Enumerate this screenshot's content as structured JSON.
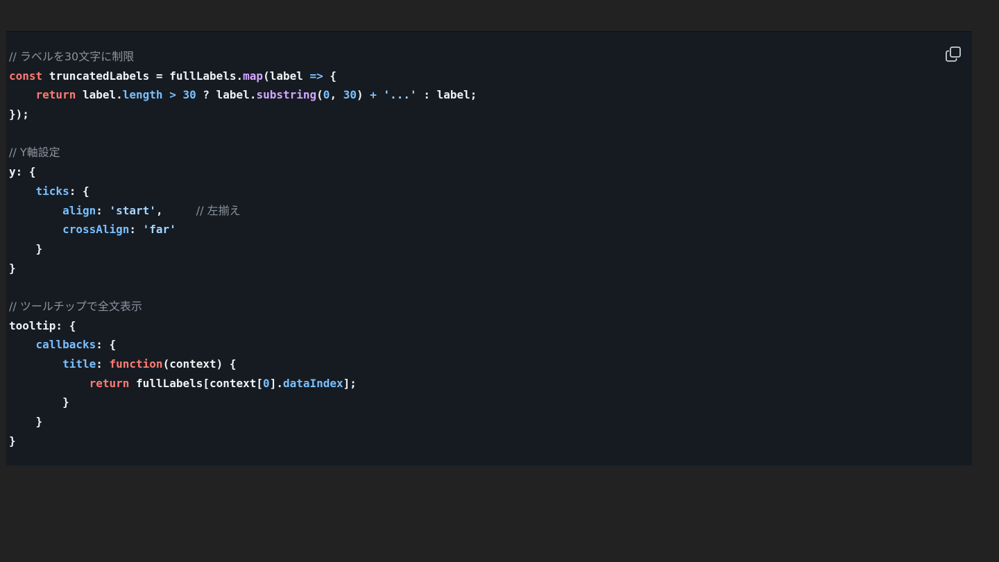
{
  "colors": {
    "background": "#222222",
    "code_background": "#161b22",
    "keyword": "#ff7b72",
    "function": "#d2a8ff",
    "property": "#79c0ff",
    "string": "#a5d6ff",
    "comment": "#8b949e",
    "text": "#f0f3f6"
  },
  "copy_button": {
    "icon": "copy-icon"
  },
  "code_lines": [
    [
      {
        "t": "cm",
        "v": "// ラベルを30文字に制限"
      }
    ],
    [
      {
        "t": "kw",
        "v": "const"
      },
      {
        "t": "plain",
        "v": " truncatedLabels = fullLabels."
      },
      {
        "t": "fn",
        "v": "map"
      },
      {
        "t": "plain",
        "v": "(label "
      },
      {
        "t": "op",
        "v": "=>"
      },
      {
        "t": "plain",
        "v": " {"
      }
    ],
    [
      {
        "t": "plain",
        "v": "    "
      },
      {
        "t": "kw",
        "v": "return"
      },
      {
        "t": "plain",
        "v": " label."
      },
      {
        "t": "prop",
        "v": "length"
      },
      {
        "t": "plain",
        "v": " "
      },
      {
        "t": "op",
        "v": ">"
      },
      {
        "t": "plain",
        "v": " "
      },
      {
        "t": "num",
        "v": "30"
      },
      {
        "t": "plain",
        "v": " ? label."
      },
      {
        "t": "fn",
        "v": "substring"
      },
      {
        "t": "plain",
        "v": "("
      },
      {
        "t": "num",
        "v": "0"
      },
      {
        "t": "plain",
        "v": ", "
      },
      {
        "t": "num",
        "v": "30"
      },
      {
        "t": "plain",
        "v": ") "
      },
      {
        "t": "op",
        "v": "+"
      },
      {
        "t": "plain",
        "v": " "
      },
      {
        "t": "str",
        "v": "'...'"
      },
      {
        "t": "plain",
        "v": " : label;"
      }
    ],
    [
      {
        "t": "plain",
        "v": "});"
      }
    ],
    [
      {
        "t": "plain",
        "v": ""
      }
    ],
    [
      {
        "t": "cm",
        "v": "// Y軸設定"
      }
    ],
    [
      {
        "t": "plain",
        "v": "y: {"
      }
    ],
    [
      {
        "t": "plain",
        "v": "    "
      },
      {
        "t": "prop",
        "v": "ticks"
      },
      {
        "t": "plain",
        "v": ": {"
      }
    ],
    [
      {
        "t": "plain",
        "v": "        "
      },
      {
        "t": "prop",
        "v": "align"
      },
      {
        "t": "plain",
        "v": ": "
      },
      {
        "t": "str",
        "v": "'start'"
      },
      {
        "t": "plain",
        "v": ",     "
      },
      {
        "t": "cm",
        "v": "// 左揃え"
      }
    ],
    [
      {
        "t": "plain",
        "v": "        "
      },
      {
        "t": "prop",
        "v": "crossAlign"
      },
      {
        "t": "plain",
        "v": ": "
      },
      {
        "t": "str",
        "v": "'far'"
      }
    ],
    [
      {
        "t": "plain",
        "v": "    }"
      }
    ],
    [
      {
        "t": "plain",
        "v": "}"
      }
    ],
    [
      {
        "t": "plain",
        "v": ""
      }
    ],
    [
      {
        "t": "cm",
        "v": "// ツールチップで全文表示"
      }
    ],
    [
      {
        "t": "plain",
        "v": "tooltip: {"
      }
    ],
    [
      {
        "t": "plain",
        "v": "    "
      },
      {
        "t": "prop",
        "v": "callbacks"
      },
      {
        "t": "plain",
        "v": ": {"
      }
    ],
    [
      {
        "t": "plain",
        "v": "        "
      },
      {
        "t": "prop",
        "v": "title"
      },
      {
        "t": "plain",
        "v": ": "
      },
      {
        "t": "kw",
        "v": "function"
      },
      {
        "t": "plain",
        "v": "(context) {"
      }
    ],
    [
      {
        "t": "plain",
        "v": "            "
      },
      {
        "t": "kw",
        "v": "return"
      },
      {
        "t": "plain",
        "v": " fullLabels[context["
      },
      {
        "t": "num",
        "v": "0"
      },
      {
        "t": "plain",
        "v": "]."
      },
      {
        "t": "prop",
        "v": "dataIndex"
      },
      {
        "t": "plain",
        "v": "];"
      }
    ],
    [
      {
        "t": "plain",
        "v": "        }"
      }
    ],
    [
      {
        "t": "plain",
        "v": "    }"
      }
    ],
    [
      {
        "t": "plain",
        "v": "}"
      }
    ]
  ]
}
